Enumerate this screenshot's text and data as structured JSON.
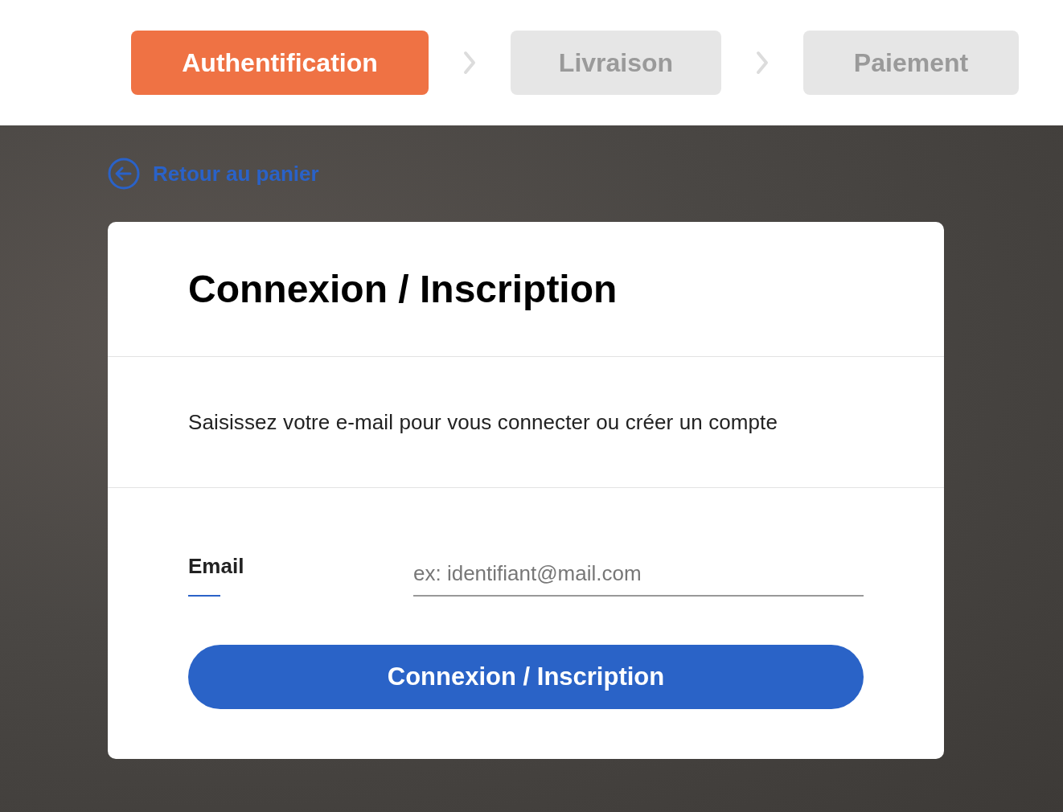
{
  "steps": [
    {
      "label": "Authentification",
      "selected": true
    },
    {
      "label": "Livraison",
      "selected": false
    },
    {
      "label": "Paiement",
      "selected": false
    }
  ],
  "back_link": {
    "label": "Retour au panier"
  },
  "card": {
    "title": "Connexion / Inscription",
    "description": "Saisissez votre e-mail pour vous connecter ou créer un compte",
    "email_field": {
      "label": "Email",
      "placeholder": "ex: identifiant@mail.com"
    },
    "submit_button": {
      "label": "Connexion / Inscription"
    }
  }
}
